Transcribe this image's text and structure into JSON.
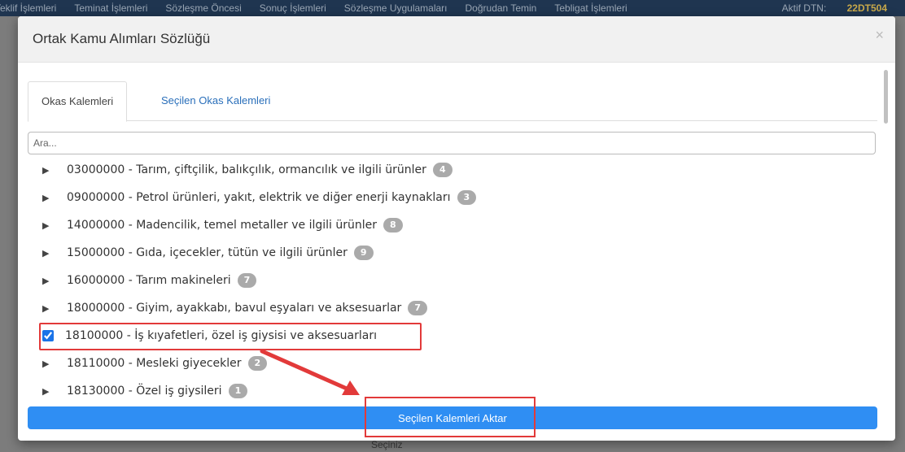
{
  "background": {
    "nav_items": [
      "Teklif İşlemleri",
      "Teminat İşlemleri",
      "Sözleşme Öncesi",
      "Sonuç İşlemleri",
      "Sözleşme Uygulamaları",
      "Doğrudan Temin",
      "Tebligat İşlemleri"
    ],
    "dtn_label": "Aktif DTN:",
    "dtn_value": "22DT504",
    "bottom_select": "Seçiniz"
  },
  "modal": {
    "title": "Ortak Kamu Alımları Sözlüğü",
    "close_label": "×",
    "tabs": [
      {
        "label": "Okas Kalemleri",
        "active": true
      },
      {
        "label": "Seçilen Okas Kalemleri",
        "active": false
      }
    ],
    "search": {
      "placeholder": "Ara...",
      "value": ""
    },
    "items": [
      {
        "text": "03000000 - Tarım, çiftçilik, balıkçılık, ormancılık ve ilgili ürünler",
        "count": "4",
        "type": "expand"
      },
      {
        "text": "09000000 - Petrol ürünleri, yakıt, elektrik ve diğer enerji kaynakları",
        "count": "3",
        "type": "expand"
      },
      {
        "text": "14000000 - Madencilik, temel metaller ve ilgili ürünler",
        "count": "8",
        "type": "expand"
      },
      {
        "text": "15000000 - Gıda, içecekler, tütün ve ilgili ürünler",
        "count": "9",
        "type": "expand"
      },
      {
        "text": "16000000 - Tarım makineleri",
        "count": "7",
        "type": "expand"
      },
      {
        "text": "18000000 - Giyim, ayakkabı, bavul eşyaları ve aksesuarlar",
        "count": "7",
        "type": "expand"
      },
      {
        "text": "18100000 - İş kıyafetleri, özel iş giysisi ve aksesuarları",
        "count": "",
        "type": "checkbox",
        "checked": true
      },
      {
        "text": "18110000 - Mesleki giyecekler",
        "count": "2",
        "type": "expand"
      },
      {
        "text": "18130000 - Özel iş giysileri",
        "count": "1",
        "type": "expand"
      }
    ],
    "submit_label": "Seçilen Kalemleri Aktar"
  },
  "annotation_color": "#e23a3a"
}
